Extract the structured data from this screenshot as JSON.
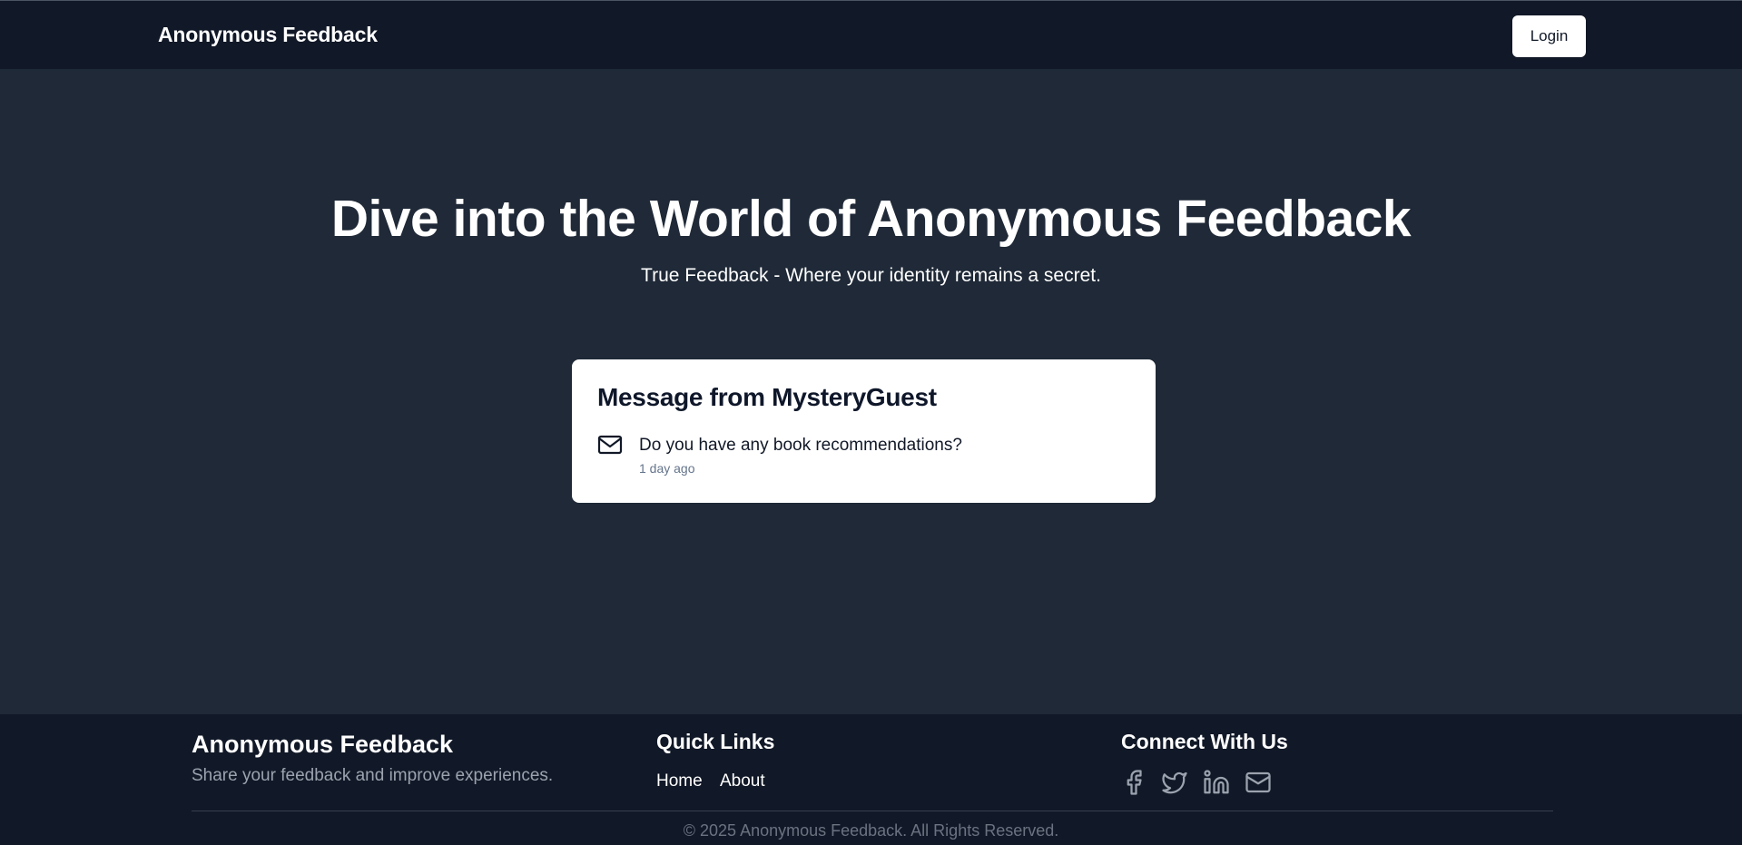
{
  "navbar": {
    "brand": "Anonymous Feedback",
    "login_label": "Login"
  },
  "hero": {
    "title": "Dive into the World of Anonymous Feedback",
    "subtitle": "True Feedback - Where your identity remains a secret."
  },
  "message_card": {
    "title": "Message from MysteryGuest",
    "icon": "mail-icon",
    "message": "Do you have any book recommendations?",
    "time": "1 day ago"
  },
  "footer": {
    "brand": "Anonymous Feedback",
    "tagline": "Share your feedback and improve experiences.",
    "quick_links": {
      "heading": "Quick Links",
      "items": [
        "Home",
        "About"
      ]
    },
    "connect": {
      "heading": "Connect With Us",
      "icons": [
        "facebook-icon",
        "twitter-icon",
        "linkedin-icon",
        "mail-icon"
      ]
    },
    "copyright": "© 2025 Anonymous Feedback. All Rights Reserved."
  },
  "colors": {
    "navbar_bg": "#111827",
    "page_bg": "#1f2937",
    "footer_bg": "#111827",
    "card_bg": "#ffffff",
    "muted_text": "#9ca3af"
  }
}
